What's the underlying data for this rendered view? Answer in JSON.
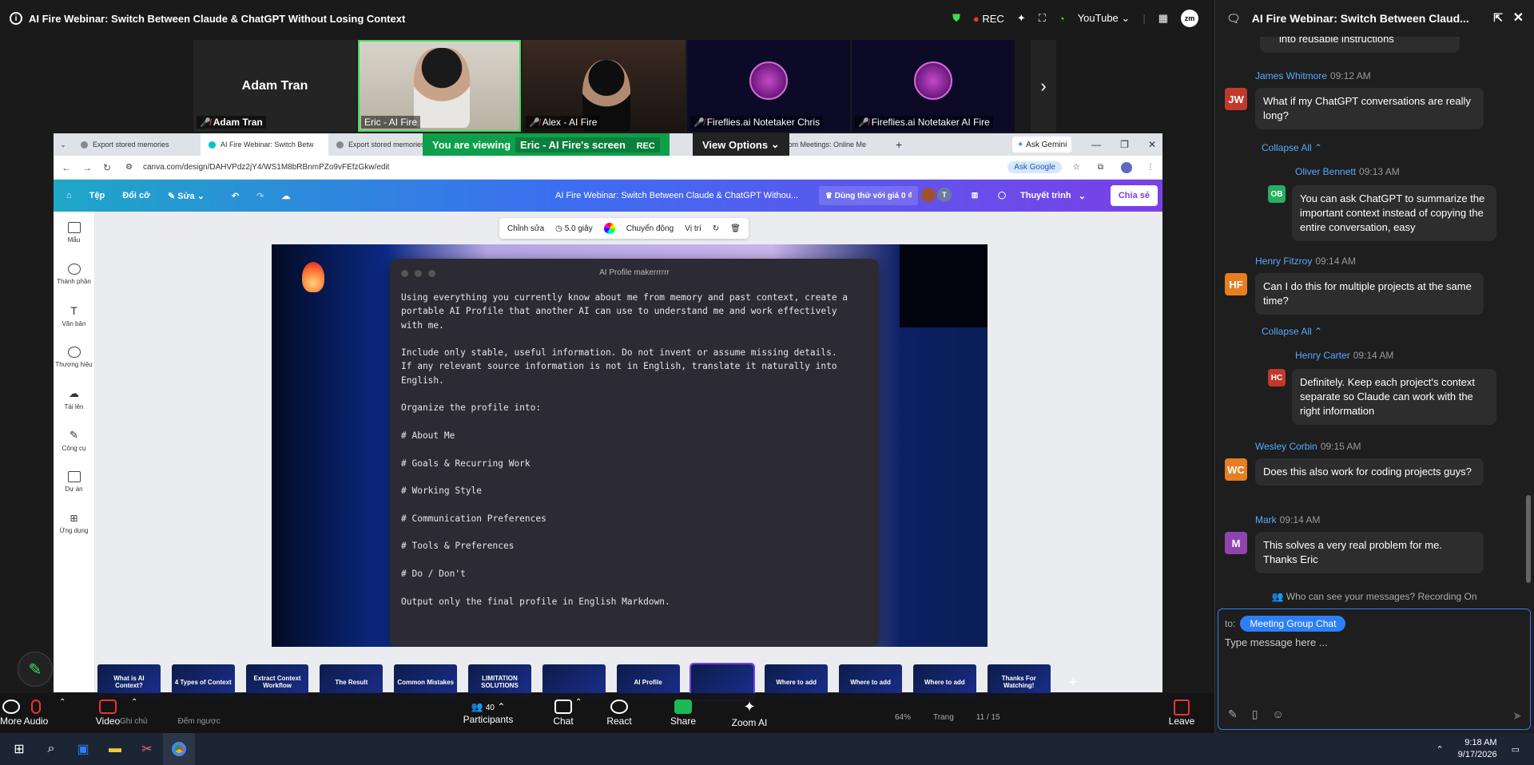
{
  "window": {
    "title": "AI Fire Webinar: Switch Between Claude & ChatGPT Without Losing Context",
    "rec": "REC",
    "youtube": "YouTube",
    "zm_badge": "zm"
  },
  "videos": [
    {
      "name": "Adam Tran",
      "label": "Adam Tran"
    },
    {
      "name": "Eric - AI Fire"
    },
    {
      "name": "Alex - AI Fire"
    },
    {
      "name": "Fireflies.ai Notetaker Chris"
    },
    {
      "name": "Fireflies.ai Notetaker AI Fire"
    }
  ],
  "browser": {
    "tabs": [
      "Export stored memories",
      "AI Fire Webinar: Switch Betw",
      "Export stored memories",
      "Zoom Meetings: Online Me"
    ],
    "viewing_prefix": "You are viewing",
    "viewing_name": "Eric - AI Fire's screen",
    "viewing_rec": "REC",
    "view_options": "View Options",
    "ask_gemini": "Ask Gemini",
    "url": "canva.com/design/DAHVPdz2jY4/WS1M8bRBnmPZo9vFEfzGkw/edit",
    "ask_google": "Ask Google"
  },
  "canva": {
    "menu": [
      "Tệp",
      "Đổi cỡ",
      "Sửa"
    ],
    "doc_title": "AI Fire Webinar: Switch Between Claude & ChatGPT Withou...",
    "try_label": "Dùng thử với giá 0 ₫",
    "present": "Thuyết trình",
    "share": "Chia sẻ",
    "avatar_t": "T",
    "side": [
      "Mẫu",
      "Thành phần",
      "Văn bản",
      "Thương hiệu",
      "Tải lên",
      "Công cụ",
      "Dự án",
      "Ứng dụng"
    ],
    "edit_bar": {
      "edit": "Chỉnh sửa",
      "duration": "5.0 giây",
      "animate": "Chuyển động",
      "position": "Vị trí"
    },
    "terminal_title": "AI Profile makerrrrrr",
    "terminal_text": "Using everything you currently know about me from memory and past context, create a\nportable AI Profile that another AI can use to understand me and work effectively\nwith me.\n\nInclude only stable, useful information. Do not invent or assume missing details.\nIf any relevant source information is not in English, translate it naturally into\nEnglish.\n\nOrganize the profile into:\n\n# About Me\n\n# Goals & Recurring Work\n\n# Working Style\n\n# Communication Preferences\n\n# Tools & Preferences\n\n# Do / Don't\n\nOutput only the final profile in English Markdown.",
    "thumbs": [
      "What is AI Context?",
      "4 Types of Context",
      "Extract Context Workflow",
      "The Result",
      "Common Mistakes",
      "LIMITATION SOLUTIONS",
      "",
      "AI Profile",
      "",
      "Where to add",
      "Where to add",
      "Where to add",
      "Thanks For Watching!"
    ],
    "page": "11 / 15",
    "zoom": "64%",
    "notes": "Ghi chú",
    "timer": "Đếm ngược",
    "pages_label": "Trang"
  },
  "toolbar": {
    "audio": "Audio",
    "video": "Video",
    "participants": "Participants",
    "participants_count": "40",
    "chat": "Chat",
    "react": "React",
    "share": "Share",
    "zoom_ai": "Zoom AI",
    "more": "More",
    "leave": "Leave"
  },
  "chat": {
    "title": "AI Fire Webinar: Switch Between Claud...",
    "top_fragment": "into reusable instructions",
    "messages": [
      {
        "name": "James Whitmore",
        "time": "09:12 AM",
        "initials": "JW",
        "color": "#c0392b",
        "text": "What if my ChatGPT conversations are really long?"
      },
      {
        "name": "Oliver Bennett",
        "time": "09:13 AM",
        "initials": "OB",
        "color": "#27ae60",
        "text": "You can ask ChatGPT to summarize the important context instead of copying the entire conversation, easy"
      },
      {
        "name": "Henry Fitzroy",
        "time": "09:14 AM",
        "initials": "HF",
        "color": "#e67e22",
        "text": "Can I do this for multiple projects at the same time?"
      },
      {
        "name": "Henry Carter",
        "time": "09:14 AM",
        "initials": "HC",
        "color": "#c0392b",
        "text": "Definitely. Keep each project's context separate so Claude can work with the right information"
      },
      {
        "name": "Wesley Corbin",
        "time": "09:15 AM",
        "initials": "WC",
        "color": "#e67e22",
        "text": "Does this also work for coding projects guys?"
      },
      {
        "name": "Mark",
        "time": "09:14 AM",
        "initials": "M",
        "color": "#8e44ad",
        "text": "This solves a very real problem for me. Thanks Eric"
      }
    ],
    "collapse": "Collapse All",
    "who_can_see": "Who can see your messages? Recording On",
    "to_label": "to:",
    "to_target": "Meeting Group Chat",
    "placeholder": "Type message here ..."
  },
  "taskbar": {
    "time": "9:18 AM",
    "date": "9/17/2026"
  }
}
